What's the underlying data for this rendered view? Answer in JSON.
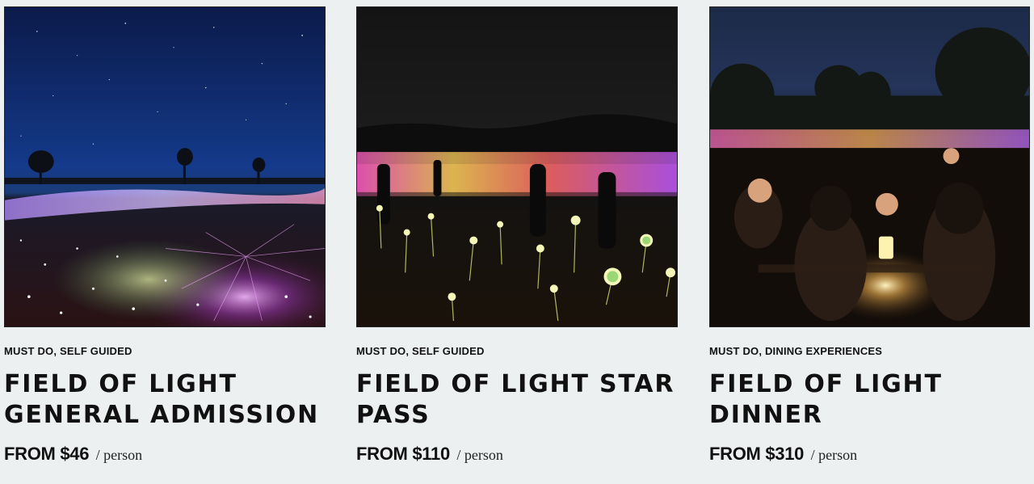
{
  "cards": [
    {
      "image_alt": "Field of Light under a starry night sky",
      "tags": "MUST DO, SELF GUIDED",
      "title": "FIELD OF LIGHT GENERAL ADMISSION",
      "price": "FROM $46",
      "unit": "/ person"
    },
    {
      "image_alt": "Visitors walking among glowing light stems",
      "tags": "MUST DO, SELF GUIDED",
      "title": "FIELD OF LIGHT STAR PASS",
      "price": "FROM $110",
      "unit": "/ person"
    },
    {
      "image_alt": "Guests dining by candlelight at dusk",
      "tags": "MUST DO, DINING EXPERIENCES",
      "title": "FIELD OF LIGHT DINNER",
      "price": "FROM $310",
      "unit": "/ person"
    }
  ],
  "colors": {
    "page_background": "#ecf0f1",
    "text": "#111111"
  }
}
